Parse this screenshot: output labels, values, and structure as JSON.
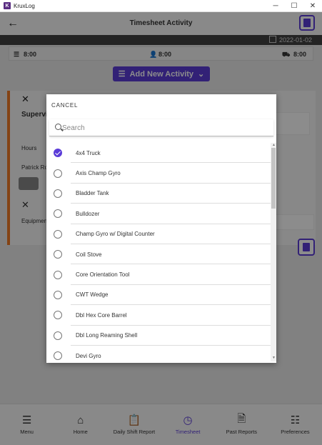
{
  "window": {
    "app_name": "KruxLog",
    "icon_letter": "K",
    "minimize": "─",
    "maximize": "☐",
    "close": "✕"
  },
  "header": {
    "title": "Timesheet Activity",
    "back_icon": "←"
  },
  "datebar": {
    "date": "2022-01-02"
  },
  "totals": {
    "total": "8:00",
    "person": "8:00",
    "equipment": "8:00"
  },
  "add_activity": {
    "label": "Add New Activity",
    "caret": "⌄"
  },
  "card": {
    "close": "✕",
    "title": "Supervi",
    "hours_label": "Hours",
    "person_label": "Patrick Roy",
    "close2": "✕",
    "equipment_label": "Equipmen"
  },
  "modal": {
    "cancel": "CANCEL",
    "search_placeholder": "Search",
    "items": [
      {
        "label": "4x4 Truck",
        "checked": true
      },
      {
        "label": "Axis Champ Gyro",
        "checked": false
      },
      {
        "label": "Bladder Tank",
        "checked": false
      },
      {
        "label": "Bulldozer",
        "checked": false
      },
      {
        "label": "Champ Gyro w/ Digital Counter",
        "checked": false
      },
      {
        "label": "Coil Stove",
        "checked": false
      },
      {
        "label": "Core Orientation Tool",
        "checked": false
      },
      {
        "label": "CWT Wedge",
        "checked": false
      },
      {
        "label": "Dbl Hex Core Barrel",
        "checked": false
      },
      {
        "label": "Dbl Long Reaming Shell",
        "checked": false
      },
      {
        "label": "Devi Gyro",
        "checked": false
      }
    ]
  },
  "nav": [
    {
      "label": "Menu",
      "icon": "☰",
      "active": false
    },
    {
      "label": "Home",
      "icon": "⌂",
      "active": false
    },
    {
      "label": "Daily Shift Report",
      "icon": "📋",
      "active": false
    },
    {
      "label": "Timesheet",
      "icon": "◷",
      "active": true
    },
    {
      "label": "Past Reports",
      "icon": "🗎",
      "active": false
    },
    {
      "label": "Preferences",
      "icon": "☷",
      "active": false
    }
  ],
  "colors": {
    "accent": "#5b3cd8",
    "card_border": "#f07a26",
    "datebar": "#424242"
  }
}
